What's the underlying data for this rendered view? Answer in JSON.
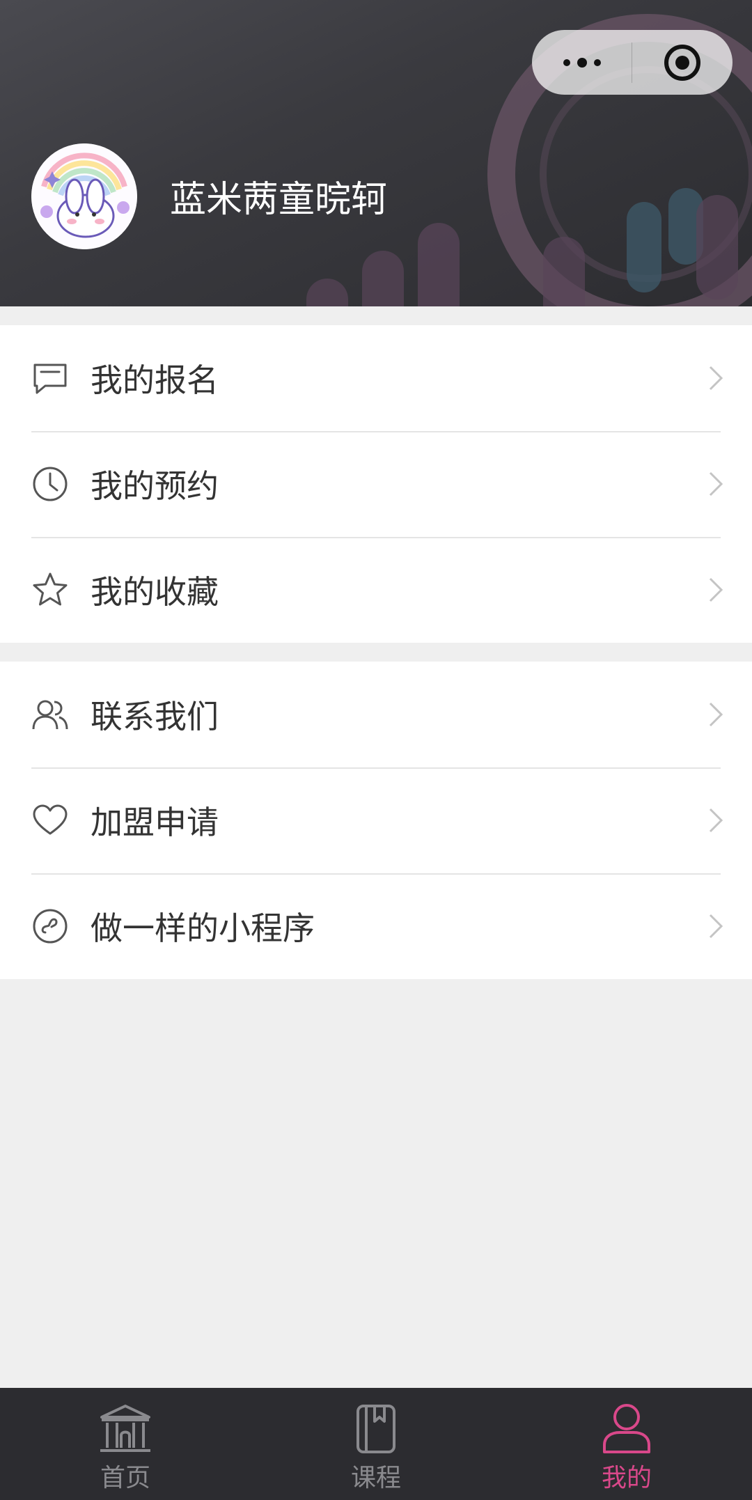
{
  "header": {
    "username": "蓝米𬜯童晥轲",
    "capsule": {
      "more_icon": "more-dots-icon",
      "close_icon": "target-icon"
    },
    "avatar_icon": "bunny-rainbow-avatar"
  },
  "menu_groups": [
    {
      "items": [
        {
          "label": "我的报名",
          "icon": "message-icon"
        },
        {
          "label": "我的预约",
          "icon": "clock-icon"
        },
        {
          "label": "我的收藏",
          "icon": "star-icon"
        }
      ]
    },
    {
      "items": [
        {
          "label": "联系我们",
          "icon": "users-icon"
        },
        {
          "label": "加盟申请",
          "icon": "heart-icon"
        },
        {
          "label": "做一样的小程序",
          "icon": "mini-program-icon"
        }
      ]
    }
  ],
  "tabbar": {
    "tabs": [
      {
        "label": "首页",
        "icon": "building-icon",
        "active": false
      },
      {
        "label": "课程",
        "icon": "book-icon",
        "active": false
      },
      {
        "label": "我的",
        "icon": "user-icon",
        "active": true
      }
    ]
  },
  "colors": {
    "header_bg": "#3a3a3f",
    "accent": "#d9488a",
    "tab_inactive": "#8a8a8e",
    "page_bg": "#efefef"
  }
}
